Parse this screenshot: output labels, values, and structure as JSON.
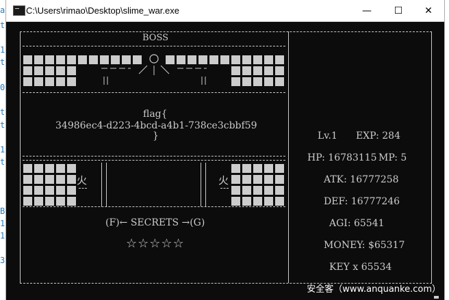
{
  "window": {
    "title": "C:\\Users\\rimao\\Desktop\\slime_war.exe",
    "minimize_glyph": "—",
    "maximize_glyph": "☐",
    "close_glyph": "✕"
  },
  "background_chars": [
    "a",
    "t",
    "1",
    "t",
    "0",
    "t",
    "t",
    "1",
    "t",
    "B",
    "1",
    "1",
    "3"
  ],
  "game": {
    "boss_label": "BOSS",
    "flag_open": "flag{",
    "flag_value": "34986ec4-d223-4bcd-a4b1-738ce3cbbf59",
    "flag_close": "}",
    "left_fire": "火",
    "right_fire": "火",
    "secrets_text": "(F)← SECRETS →(G)",
    "stars": "☆☆☆☆☆",
    "boss_eye": "O"
  },
  "stats": {
    "level": "Lv.1",
    "exp": "EXP: 284",
    "hp": "HP: 16783115",
    "mp": "MP: 5",
    "atk": "ATK: 16777258",
    "def": "DEF: 16777246",
    "agi": "AGI: 65541",
    "money": "MONEY: $65317",
    "key": "KEY x 65534"
  },
  "watermark": "安全客（www.anquanke.com）"
}
